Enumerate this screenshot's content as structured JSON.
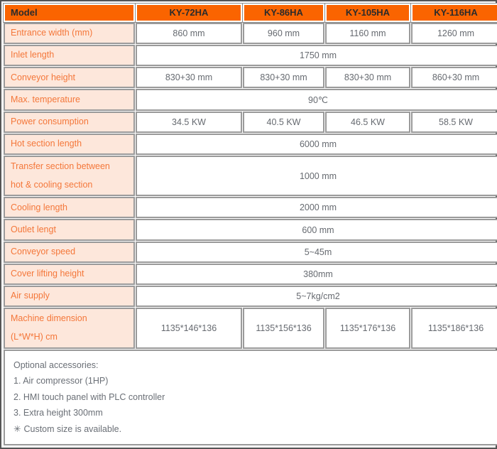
{
  "table": {
    "header": {
      "label": "Model",
      "models": [
        "KY-72HA",
        "KY-86HA",
        "KY-105HA",
        "KY-116HA"
      ]
    },
    "rows": [
      {
        "label": "Entrance width (mm)",
        "merged": false,
        "values": [
          "860 mm",
          "960 mm",
          "1160 mm",
          "1260 mm"
        ]
      },
      {
        "label": "Inlet length",
        "merged": true,
        "value": "1750 mm"
      },
      {
        "label": "Conveyor height",
        "merged": false,
        "values": [
          "830+30 mm",
          "830+30 mm",
          "830+30 mm",
          "860+30 mm"
        ]
      },
      {
        "label": "Max. temperature",
        "merged": true,
        "value": "90℃"
      },
      {
        "label": "Power consumption",
        "merged": false,
        "values": [
          "34.5 KW",
          "40.5 KW",
          "46.5 KW",
          "58.5 KW"
        ]
      },
      {
        "label": "Hot section length",
        "merged": true,
        "value": "6000 mm"
      },
      {
        "label_line1": "Transfer section between",
        "label_line2": "hot & cooling section",
        "merged": true,
        "value": "1000 mm"
      },
      {
        "label": "Cooling length",
        "merged": true,
        "value": "2000 mm"
      },
      {
        "label": "Outlet lengt",
        "merged": true,
        "value": "600 mm"
      },
      {
        "label": "Conveyor speed",
        "merged": true,
        "value": "5~45m"
      },
      {
        "label": "Cover lifting height",
        "merged": true,
        "value": "380mm"
      },
      {
        "label": "Air supply",
        "merged": true,
        "value": "5~7kg/cm2"
      },
      {
        "label_line1": "Machine dimension",
        "label_line2": "(L*W*H) cm",
        "merged": false,
        "values": [
          "1135*146*136",
          "1135*156*136",
          "1135*176*136",
          "1135*186*136"
        ]
      }
    ],
    "notes": {
      "title": "Optional accessories:",
      "items": [
        "1. Air compressor (1HP)",
        "2. HMI touch panel with PLC controller",
        "3. Extra height 300mm"
      ],
      "asterisk_symbol": "✳",
      "asterisk_note": "Custom size is available."
    }
  },
  "colors": {
    "header_orange": "#fa6400",
    "label_background": "#fde7db",
    "label_text": "#f4773a",
    "value_text": "#666a70",
    "border": "#9a9a9a"
  }
}
